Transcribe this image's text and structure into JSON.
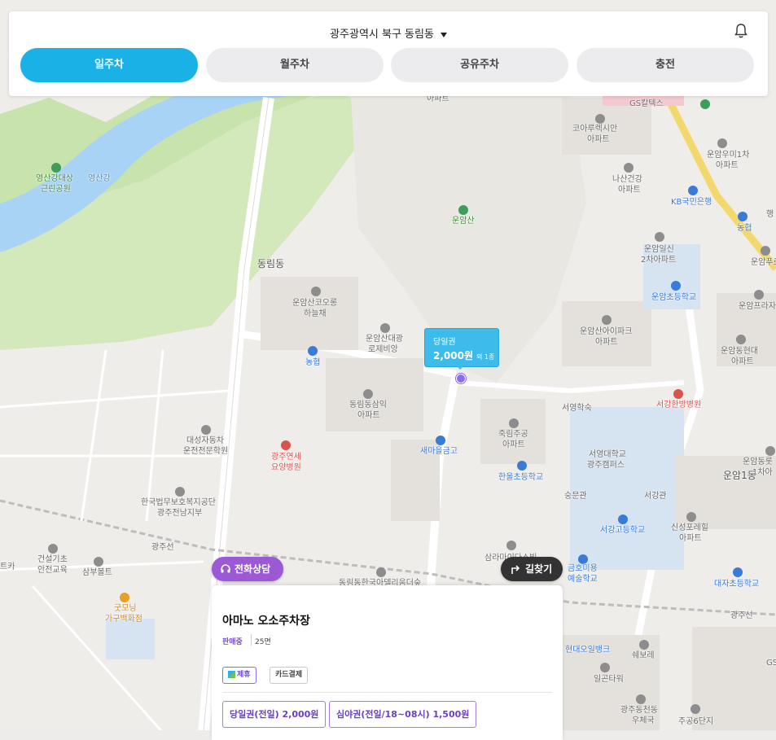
{
  "header": {
    "location": "광주광역시 북구 동림동",
    "tabs": [
      {
        "label": "일주차",
        "active": true
      },
      {
        "label": "월주차",
        "active": false
      },
      {
        "label": "공유주차",
        "active": false
      },
      {
        "label": "충전",
        "active": false
      }
    ]
  },
  "map": {
    "labels": {
      "apt_top": "아파트",
      "gs": "GS칼텍스",
      "korea_apt": "코아루렉시안",
      "korea_apt2": "아파트",
      "unam_umi": "운암우미1차",
      "unam_umi2": "아파트",
      "nasan": "나산건강",
      "nasan2": "아파트",
      "kb": "KB국민은행",
      "nonghyup_r": "농협",
      "yeongsan_park": "영산강대상",
      "yeongsan_park2": "근린공원",
      "yeongsan_river": "영산강",
      "unamsan": "운암산",
      "dongnim_dong": "동림동",
      "unam_ilsin": "운암일신",
      "unam_ilsin2": "2차아파트",
      "unam_elem": "운암초등학교",
      "unam_prugi": "운암푸르지",
      "unam_prugi2": "운암프라자",
      "unamsan_colon": "운암산코오롱",
      "unamsan_colon2": "하늘채",
      "unamsan_daegwang": "운암산대광",
      "unamsan_daegwang2": "로제비앙",
      "unamsan_ipark": "운암산아이파크",
      "unamsan_ipark2": "아파트",
      "unam_hyundai": "운암동현대",
      "unam_hyundai2": "아파트",
      "nonghyup_l": "농협",
      "dongnim_samik": "동림동삼익",
      "dongnim_samik2": "아파트",
      "seogang_hospital": "서강한방병원",
      "seoyoung_dorm": "서영학숙",
      "jukrim": "죽림주공",
      "jukrim2": "아파트",
      "saemaeul": "새마을금고",
      "daeseong_driving": "대성자동차",
      "daeseong_driving2": "운전전문학원",
      "yonsei_hospital": "광주연세",
      "yonsei_hospital2": "요양병원",
      "seoyoung_univ": "서영대학교",
      "seoyoung_univ2": "광주캠퍼스",
      "unam_lotte": "운암동롯",
      "unam_lotte2": "1차아",
      "unam1dong": "운암1동",
      "hanul_elem": "한울초등학교",
      "sungmungwan": "숭문관",
      "seogangwan": "서강관",
      "legal_aid": "한국법무보호복지공단",
      "legal_aid2": "광주전남지부",
      "seogang_high": "서강고등학교",
      "sinseong": "신성포레힐",
      "sinseong2": "아파트",
      "gwangjuseon_l": "광주선",
      "construction": "건설기초",
      "construction2": "안전교육",
      "sambu": "삼부볼트",
      "tka": "트카",
      "samra": "삼라마이다스빌",
      "dongnim_riverside": "동림동한국아델리움더숲",
      "geumho_art": "금호미용",
      "geumho_art2": "예술학교",
      "daeja_elem": "대자초등학교",
      "gudmorning": "굿모닝",
      "gudmorning2": "가구백화점",
      "gwangjuseon_r": "광주선",
      "hyundai_oil": "현대오일뱅크",
      "shebore": "쉐보레",
      "ilgeun": "일곤타워",
      "gwangju_post": "광주동천동",
      "gwangju_post2": "우체국",
      "jugong6": "주공6단지",
      "haeng": "행",
      "gs_r": "GS"
    },
    "bubble": {
      "type": "당일권",
      "price": "2,000원",
      "extra": "외 1종"
    }
  },
  "actions": {
    "call": "전화상담",
    "directions": "길찾기"
  },
  "lot": {
    "name": "아마노 오소주차장",
    "status": "판매중",
    "spaces": "25면",
    "tags": [
      "제휴",
      "카드결제"
    ],
    "prices": [
      "당일권(전일) 2,000원",
      "심야권(전일/18~08시) 1,500원"
    ]
  },
  "colors": {
    "accent": "#1ab1e6",
    "purple": "#9b59d6",
    "river": "#a9d3f5",
    "park": "#cfe6b5"
  }
}
